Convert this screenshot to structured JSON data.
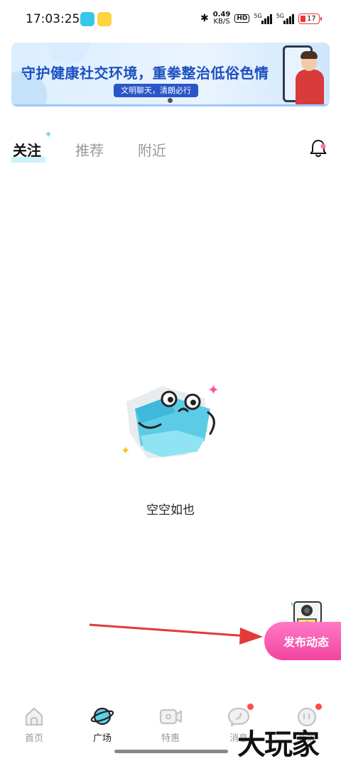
{
  "status_bar": {
    "time": "17:03:25",
    "net_speed_value": "0.49",
    "net_speed_unit": "KB/S",
    "hd_label": "HD",
    "sim1_label": "5G",
    "sim2_label": "5G",
    "battery_level": "17",
    "battery_color": "#e33333"
  },
  "banner": {
    "title": "守护健康社交环境，重拳整治低俗色情",
    "tag": "文明聊天，清朗必行"
  },
  "tabs": [
    {
      "label": "关注",
      "active": true
    },
    {
      "label": "推荐",
      "active": false
    },
    {
      "label": "附近",
      "active": false
    }
  ],
  "empty_state": {
    "text": "空空如也"
  },
  "publish_button": {
    "label": "发布动态",
    "color": "#f2449f"
  },
  "bottom_nav": [
    {
      "label": "首页",
      "icon": "home-icon",
      "active": false,
      "badge": false
    },
    {
      "label": "广场",
      "icon": "planet-icon",
      "active": true,
      "badge": false
    },
    {
      "label": "特惠",
      "icon": "video-camera-icon",
      "active": false,
      "badge": false
    },
    {
      "label": "消息",
      "icon": "chat-bubble-icon",
      "active": false,
      "badge": true
    },
    {
      "label": "我的",
      "icon": "profile-icon",
      "active": false,
      "badge": true
    }
  ],
  "watermark": "大玩家"
}
